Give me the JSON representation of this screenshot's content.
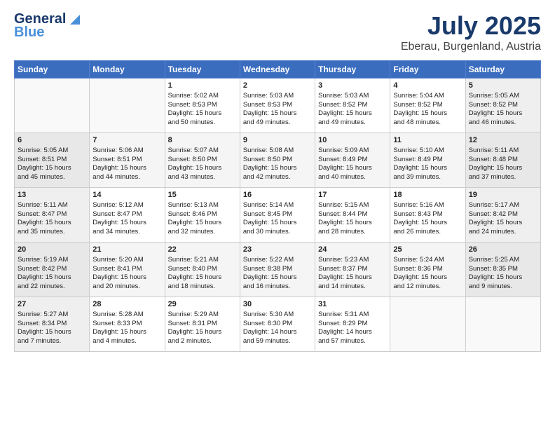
{
  "header": {
    "logo_line1": "General",
    "logo_line2": "Blue",
    "title": "July 2025",
    "subtitle": "Eberau, Burgenland, Austria"
  },
  "weekdays": [
    "Sunday",
    "Monday",
    "Tuesday",
    "Wednesday",
    "Thursday",
    "Friday",
    "Saturday"
  ],
  "weeks": [
    [
      {
        "day": "",
        "lines": []
      },
      {
        "day": "",
        "lines": []
      },
      {
        "day": "1",
        "lines": [
          "Sunrise: 5:02 AM",
          "Sunset: 8:53 PM",
          "Daylight: 15 hours",
          "and 50 minutes."
        ]
      },
      {
        "day": "2",
        "lines": [
          "Sunrise: 5:03 AM",
          "Sunset: 8:53 PM",
          "Daylight: 15 hours",
          "and 49 minutes."
        ]
      },
      {
        "day": "3",
        "lines": [
          "Sunrise: 5:03 AM",
          "Sunset: 8:52 PM",
          "Daylight: 15 hours",
          "and 49 minutes."
        ]
      },
      {
        "day": "4",
        "lines": [
          "Sunrise: 5:04 AM",
          "Sunset: 8:52 PM",
          "Daylight: 15 hours",
          "and 48 minutes."
        ]
      },
      {
        "day": "5",
        "lines": [
          "Sunrise: 5:05 AM",
          "Sunset: 8:52 PM",
          "Daylight: 15 hours",
          "and 46 minutes."
        ]
      }
    ],
    [
      {
        "day": "6",
        "lines": [
          "Sunrise: 5:05 AM",
          "Sunset: 8:51 PM",
          "Daylight: 15 hours",
          "and 45 minutes."
        ]
      },
      {
        "day": "7",
        "lines": [
          "Sunrise: 5:06 AM",
          "Sunset: 8:51 PM",
          "Daylight: 15 hours",
          "and 44 minutes."
        ]
      },
      {
        "day": "8",
        "lines": [
          "Sunrise: 5:07 AM",
          "Sunset: 8:50 PM",
          "Daylight: 15 hours",
          "and 43 minutes."
        ]
      },
      {
        "day": "9",
        "lines": [
          "Sunrise: 5:08 AM",
          "Sunset: 8:50 PM",
          "Daylight: 15 hours",
          "and 42 minutes."
        ]
      },
      {
        "day": "10",
        "lines": [
          "Sunrise: 5:09 AM",
          "Sunset: 8:49 PM",
          "Daylight: 15 hours",
          "and 40 minutes."
        ]
      },
      {
        "day": "11",
        "lines": [
          "Sunrise: 5:10 AM",
          "Sunset: 8:49 PM",
          "Daylight: 15 hours",
          "and 39 minutes."
        ]
      },
      {
        "day": "12",
        "lines": [
          "Sunrise: 5:11 AM",
          "Sunset: 8:48 PM",
          "Daylight: 15 hours",
          "and 37 minutes."
        ]
      }
    ],
    [
      {
        "day": "13",
        "lines": [
          "Sunrise: 5:11 AM",
          "Sunset: 8:47 PM",
          "Daylight: 15 hours",
          "and 35 minutes."
        ]
      },
      {
        "day": "14",
        "lines": [
          "Sunrise: 5:12 AM",
          "Sunset: 8:47 PM",
          "Daylight: 15 hours",
          "and 34 minutes."
        ]
      },
      {
        "day": "15",
        "lines": [
          "Sunrise: 5:13 AM",
          "Sunset: 8:46 PM",
          "Daylight: 15 hours",
          "and 32 minutes."
        ]
      },
      {
        "day": "16",
        "lines": [
          "Sunrise: 5:14 AM",
          "Sunset: 8:45 PM",
          "Daylight: 15 hours",
          "and 30 minutes."
        ]
      },
      {
        "day": "17",
        "lines": [
          "Sunrise: 5:15 AM",
          "Sunset: 8:44 PM",
          "Daylight: 15 hours",
          "and 28 minutes."
        ]
      },
      {
        "day": "18",
        "lines": [
          "Sunrise: 5:16 AM",
          "Sunset: 8:43 PM",
          "Daylight: 15 hours",
          "and 26 minutes."
        ]
      },
      {
        "day": "19",
        "lines": [
          "Sunrise: 5:17 AM",
          "Sunset: 8:42 PM",
          "Daylight: 15 hours",
          "and 24 minutes."
        ]
      }
    ],
    [
      {
        "day": "20",
        "lines": [
          "Sunrise: 5:19 AM",
          "Sunset: 8:42 PM",
          "Daylight: 15 hours",
          "and 22 minutes."
        ]
      },
      {
        "day": "21",
        "lines": [
          "Sunrise: 5:20 AM",
          "Sunset: 8:41 PM",
          "Daylight: 15 hours",
          "and 20 minutes."
        ]
      },
      {
        "day": "22",
        "lines": [
          "Sunrise: 5:21 AM",
          "Sunset: 8:40 PM",
          "Daylight: 15 hours",
          "and 18 minutes."
        ]
      },
      {
        "day": "23",
        "lines": [
          "Sunrise: 5:22 AM",
          "Sunset: 8:38 PM",
          "Daylight: 15 hours",
          "and 16 minutes."
        ]
      },
      {
        "day": "24",
        "lines": [
          "Sunrise: 5:23 AM",
          "Sunset: 8:37 PM",
          "Daylight: 15 hours",
          "and 14 minutes."
        ]
      },
      {
        "day": "25",
        "lines": [
          "Sunrise: 5:24 AM",
          "Sunset: 8:36 PM",
          "Daylight: 15 hours",
          "and 12 minutes."
        ]
      },
      {
        "day": "26",
        "lines": [
          "Sunrise: 5:25 AM",
          "Sunset: 8:35 PM",
          "Daylight: 15 hours",
          "and 9 minutes."
        ]
      }
    ],
    [
      {
        "day": "27",
        "lines": [
          "Sunrise: 5:27 AM",
          "Sunset: 8:34 PM",
          "Daylight: 15 hours",
          "and 7 minutes."
        ]
      },
      {
        "day": "28",
        "lines": [
          "Sunrise: 5:28 AM",
          "Sunset: 8:33 PM",
          "Daylight: 15 hours",
          "and 4 minutes."
        ]
      },
      {
        "day": "29",
        "lines": [
          "Sunrise: 5:29 AM",
          "Sunset: 8:31 PM",
          "Daylight: 15 hours",
          "and 2 minutes."
        ]
      },
      {
        "day": "30",
        "lines": [
          "Sunrise: 5:30 AM",
          "Sunset: 8:30 PM",
          "Daylight: 14 hours",
          "and 59 minutes."
        ]
      },
      {
        "day": "31",
        "lines": [
          "Sunrise: 5:31 AM",
          "Sunset: 8:29 PM",
          "Daylight: 14 hours",
          "and 57 minutes."
        ]
      },
      {
        "day": "",
        "lines": []
      },
      {
        "day": "",
        "lines": []
      }
    ]
  ]
}
